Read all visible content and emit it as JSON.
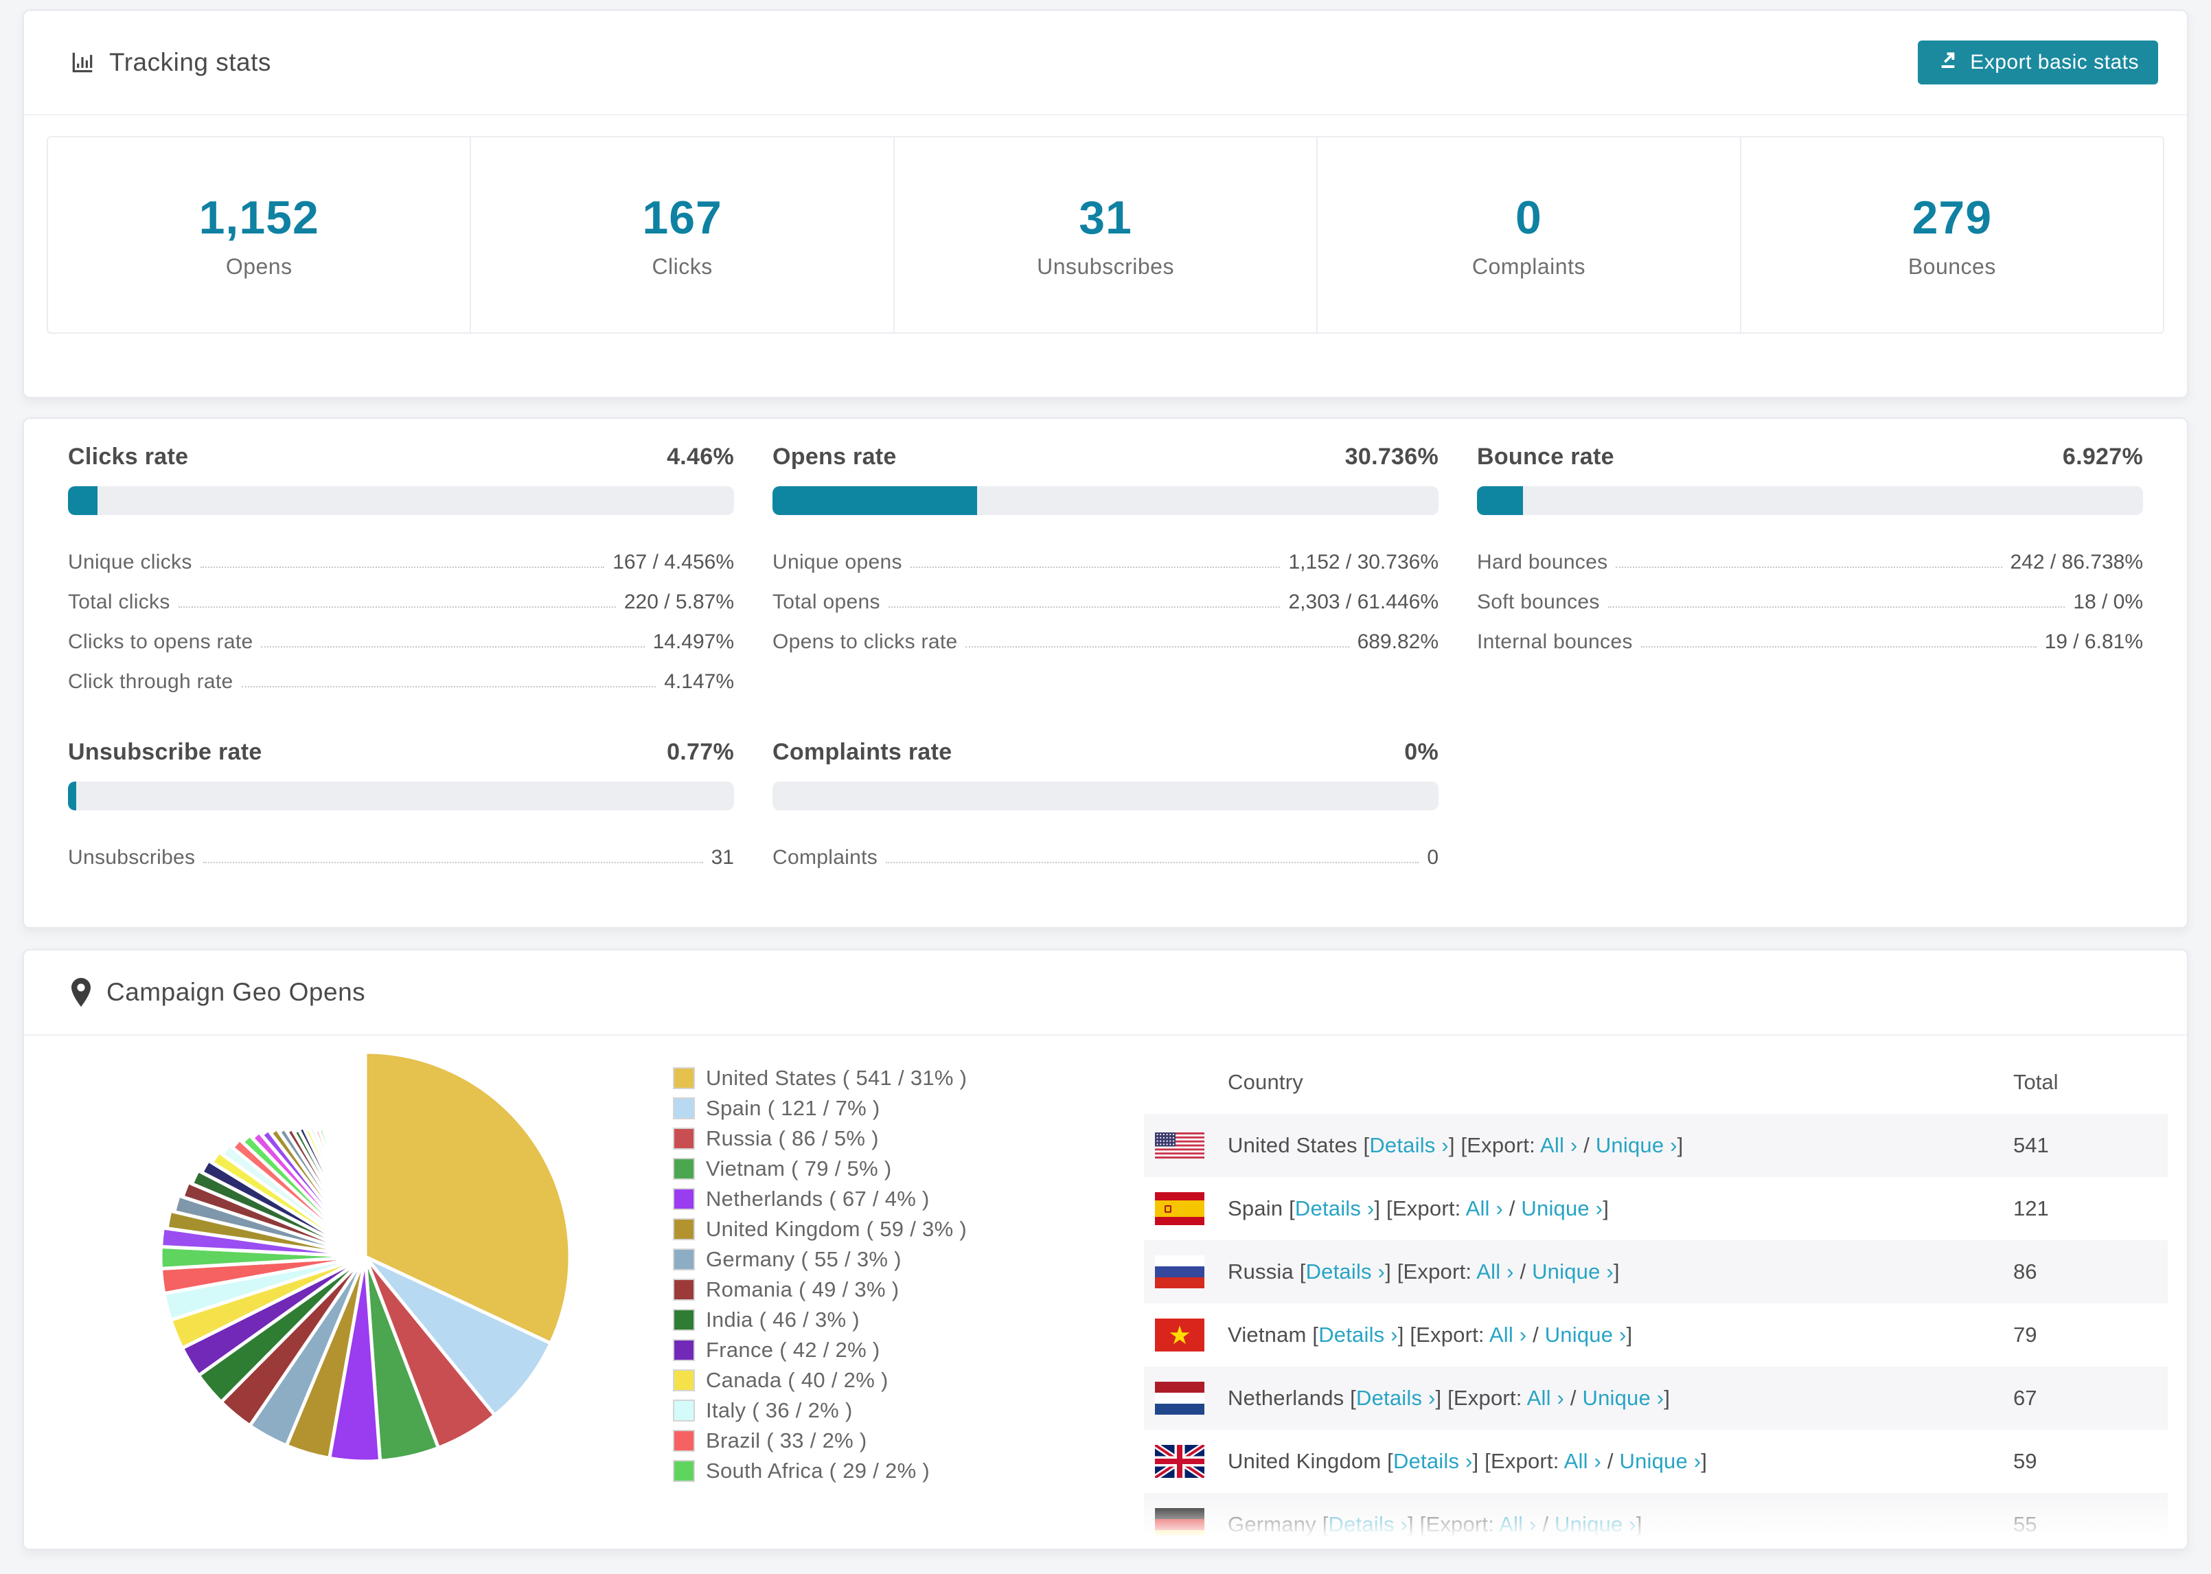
{
  "accent_color": "#0f81a2",
  "button_color": "#1b8a9e",
  "link_color": "#27a4c4",
  "tracking": {
    "title": "Tracking stats",
    "export_label": "Export basic stats",
    "stats": [
      {
        "value": "1,152",
        "label": "Opens"
      },
      {
        "value": "167",
        "label": "Clicks"
      },
      {
        "value": "31",
        "label": "Unsubscribes"
      },
      {
        "value": "0",
        "label": "Complaints"
      },
      {
        "value": "279",
        "label": "Bounces"
      }
    ]
  },
  "rates": [
    {
      "title": "Clicks rate",
      "value": "4.46%",
      "percent": 4.46,
      "rows": [
        {
          "label": "Unique clicks",
          "value": "167 / 4.456%"
        },
        {
          "label": "Total clicks",
          "value": "220 / 5.87%"
        },
        {
          "label": "Clicks to opens rate",
          "value": "14.497%"
        },
        {
          "label": "Click through rate",
          "value": "4.147%"
        }
      ]
    },
    {
      "title": "Opens rate",
      "value": "30.736%",
      "percent": 30.736,
      "rows": [
        {
          "label": "Unique opens",
          "value": "1,152 / 30.736%"
        },
        {
          "label": "Total opens",
          "value": "2,303 / 61.446%"
        },
        {
          "label": "Opens to clicks rate",
          "value": "689.82%"
        }
      ]
    },
    {
      "title": "Bounce rate",
      "value": "6.927%",
      "percent": 6.927,
      "rows": [
        {
          "label": "Hard bounces",
          "value": "242 / 86.738%"
        },
        {
          "label": "Soft bounces",
          "value": "18 / 0%"
        },
        {
          "label": "Internal bounces",
          "value": "19 / 6.81%"
        }
      ]
    },
    {
      "title": "Unsubscribe rate",
      "value": "0.77%",
      "percent": 0.77,
      "rows": [
        {
          "label": "Unsubscribes",
          "value": "31"
        }
      ]
    },
    {
      "title": "Complaints rate",
      "value": "0%",
      "percent": 0,
      "rows": [
        {
          "label": "Complaints",
          "value": "0"
        }
      ]
    }
  ],
  "geo": {
    "title": "Campaign Geo Opens",
    "table": {
      "header_country": "Country",
      "header_total": "Total",
      "links": {
        "details": "Details ›",
        "export_prefix": "Export:",
        "all": "All ›",
        "unique": "Unique ›"
      },
      "rows": [
        {
          "flag": "us",
          "country": "United States",
          "total": "541"
        },
        {
          "flag": "es",
          "country": "Spain",
          "total": "121"
        },
        {
          "flag": "ru",
          "country": "Russia",
          "total": "86"
        },
        {
          "flag": "vn",
          "country": "Vietnam",
          "total": "79"
        },
        {
          "flag": "nl",
          "country": "Netherlands",
          "total": "67"
        },
        {
          "flag": "gb",
          "country": "United Kingdom",
          "total": "59"
        },
        {
          "flag": "de",
          "country": "Germany",
          "total": "55"
        }
      ]
    }
  },
  "chart_data": {
    "type": "pie",
    "title": "Campaign Geo Opens",
    "unit": "opens",
    "legend_position": "right",
    "start_angle_deg": -90,
    "direction": "clockwise",
    "series": [
      {
        "name": "United States",
        "value": 541,
        "pct": 31,
        "color": "#e5c14e"
      },
      {
        "name": "Spain",
        "value": 121,
        "pct": 7,
        "color": "#b8d9f2"
      },
      {
        "name": "Russia",
        "value": 86,
        "pct": 5,
        "color": "#c94e52"
      },
      {
        "name": "Vietnam",
        "value": 79,
        "pct": 5,
        "color": "#4ba64f"
      },
      {
        "name": "Netherlands",
        "value": 67,
        "pct": 4,
        "color": "#9a3cf0"
      },
      {
        "name": "United Kingdom",
        "value": 59,
        "pct": 3,
        "color": "#b2932f"
      },
      {
        "name": "Germany",
        "value": 55,
        "pct": 3,
        "color": "#8cadc4"
      },
      {
        "name": "Romania",
        "value": 49,
        "pct": 3,
        "color": "#9c3a3a"
      },
      {
        "name": "India",
        "value": 46,
        "pct": 3,
        "color": "#2e7d33"
      },
      {
        "name": "France",
        "value": 42,
        "pct": 2,
        "color": "#7229b8"
      },
      {
        "name": "Canada",
        "value": 40,
        "pct": 2,
        "color": "#f5e24b"
      },
      {
        "name": "Italy",
        "value": 36,
        "pct": 2,
        "color": "#d4fbf9"
      },
      {
        "name": "Brazil",
        "value": 33,
        "pct": 2,
        "color": "#f66161"
      },
      {
        "name": "South Africa",
        "value": 29,
        "pct": 2,
        "color": "#5fd45f"
      }
    ],
    "others_unlabeled": {
      "values": [
        25,
        24,
        23,
        22,
        21,
        20,
        19,
        18,
        17,
        16,
        15,
        14,
        13,
        12,
        11,
        10,
        10,
        9,
        9,
        8,
        8,
        7,
        7,
        6,
        6,
        5,
        5,
        5,
        4,
        4,
        4,
        3,
        3,
        3,
        3,
        2,
        2,
        2,
        2,
        2,
        2,
        1,
        1,
        1,
        1,
        1,
        1,
        1,
        1,
        1
      ],
      "palette": [
        "#9a4df0",
        "#a6902d",
        "#7e97ab",
        "#8f3a3a",
        "#2f6d33",
        "#2b2b6e",
        "#f4ef4f",
        "#dffbfa",
        "#fb6f6f",
        "#62e462",
        "#e052e8"
      ]
    }
  }
}
